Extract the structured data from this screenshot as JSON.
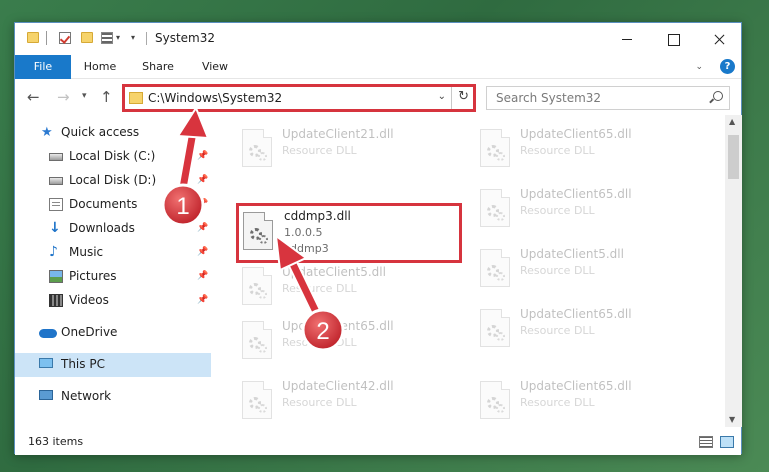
{
  "window": {
    "title": "System32"
  },
  "ribbon": {
    "tabs": [
      "File",
      "Home",
      "Share",
      "View"
    ],
    "help_label": "?"
  },
  "nav": {
    "address": "C:\\Windows\\System32",
    "search_placeholder": "Search System32"
  },
  "sidebar": {
    "items": [
      {
        "label": "Quick access",
        "icon": "star-icon"
      },
      {
        "label": "Local Disk (C:)",
        "icon": "drive-icon",
        "pinned": true
      },
      {
        "label": "Local Disk (D:)",
        "icon": "drive-icon",
        "pinned": true
      },
      {
        "label": "Documents",
        "icon": "documents-icon",
        "pinned": true
      },
      {
        "label": "Downloads",
        "icon": "downloads-icon",
        "pinned": true
      },
      {
        "label": "Music",
        "icon": "music-icon",
        "pinned": true
      },
      {
        "label": "Pictures",
        "icon": "pictures-icon",
        "pinned": true
      },
      {
        "label": "Videos",
        "icon": "videos-icon",
        "pinned": true
      },
      {
        "label": "OneDrive",
        "icon": "onedrive-icon"
      },
      {
        "label": "This PC",
        "icon": "pc-icon",
        "selected": true
      },
      {
        "label": "Network",
        "icon": "network-icon"
      }
    ]
  },
  "files": {
    "left": [
      {
        "name": "UpdateClient21.dll",
        "type": "Resource DLL"
      },
      {
        "name": "UpdateClient5.dll",
        "type": "Resource DLL"
      },
      {
        "name": "UpdateClient65.dll",
        "type": "Resource DLL"
      },
      {
        "name": "UpdateClient42.dll",
        "type": "Resource DLL"
      }
    ],
    "right": [
      {
        "name": "UpdateClient65.dll",
        "type": "Resource DLL"
      },
      {
        "name": "UpdateClient65.dll",
        "type": "Resource DLL"
      },
      {
        "name": "UpdateClient5.dll",
        "type": "Resource DLL"
      },
      {
        "name": "UpdateClient65.dll",
        "type": "Resource DLL"
      },
      {
        "name": "UpdateClient65.dll",
        "type": "Resource DLL"
      }
    ],
    "highlighted": {
      "name": "cddmp3.dll",
      "version": "1.0.0.5",
      "description": "cddmp3"
    }
  },
  "status": {
    "item_count": "163 items"
  },
  "annotations": {
    "step1": "1",
    "step2": "2"
  },
  "colors": {
    "accent": "#1979ca",
    "highlight_border": "#d6343e",
    "selected_bg": "#cce4f7"
  }
}
